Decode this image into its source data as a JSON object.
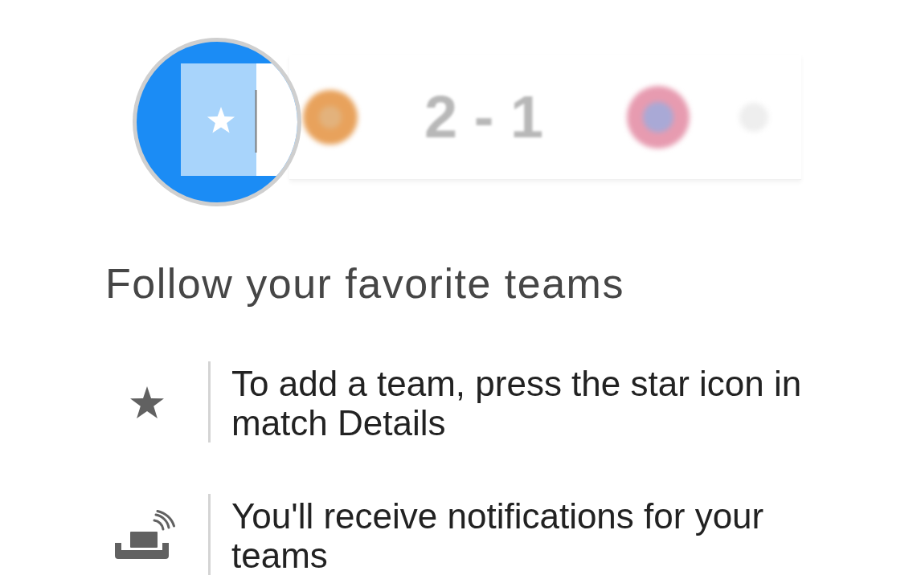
{
  "preview": {
    "score": "2 - 1"
  },
  "title": "Follow your favorite teams",
  "tips": [
    {
      "kind": "star",
      "text": "To add a team, press the star icon in match Details"
    },
    {
      "kind": "notification",
      "text": "You'll receive notifications for your teams"
    }
  ]
}
